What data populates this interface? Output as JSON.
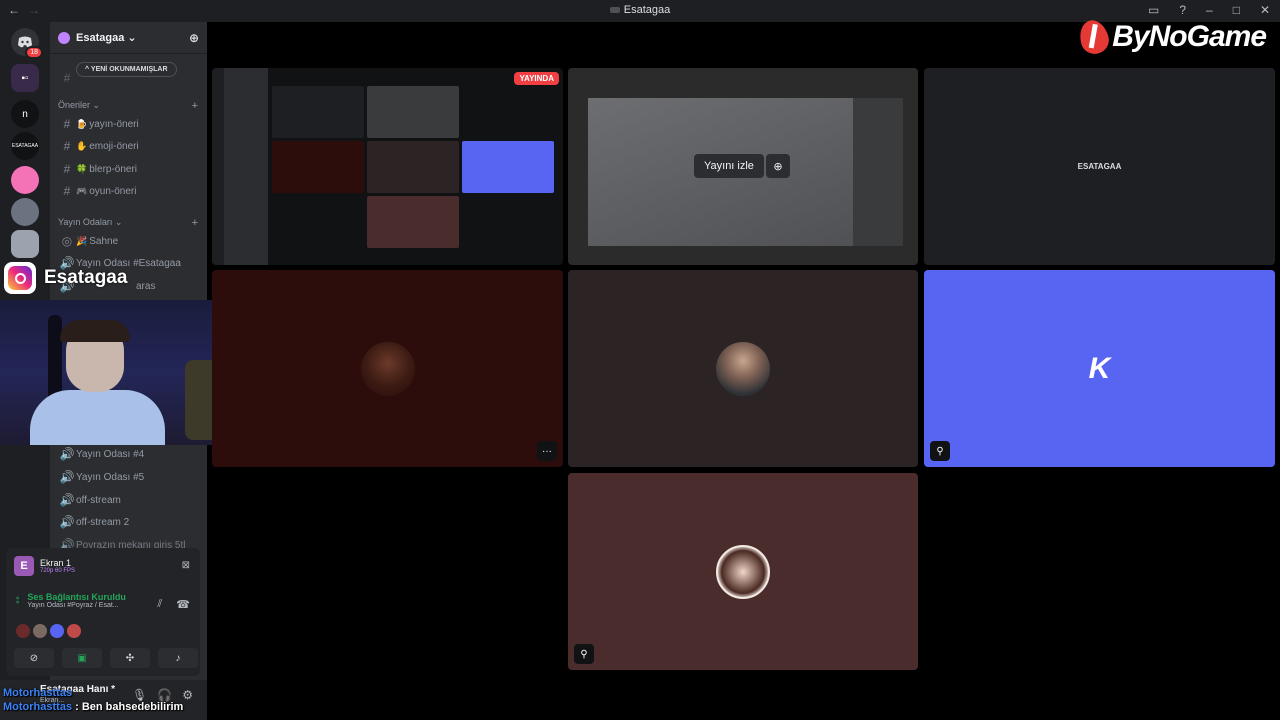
{
  "window": {
    "title": "Esatagaa"
  },
  "server": {
    "name": "Esatagaa",
    "unread_label": "YENİ OKUNMAMIŞLAR"
  },
  "rail": {
    "items": [
      {
        "icon": "discord-icon",
        "badge": "18"
      },
      {
        "icon": "server-icon"
      },
      {
        "icon": "server-icon",
        "label": "n"
      },
      {
        "icon": "server-icon",
        "label": "ESATAGAA"
      },
      {
        "icon": "server-icon"
      },
      {
        "icon": "server-icon"
      },
      {
        "icon": "server-icon"
      }
    ]
  },
  "categories": {
    "oneriler": "Öneriler",
    "yayin_odalari": "Yayın Odaları"
  },
  "channels": {
    "suggestions": [
      {
        "emoji": "🍺",
        "name": "yayın-öneri"
      },
      {
        "emoji": "✋",
        "name": "emoji-öneri"
      },
      {
        "emoji": "🍀",
        "name": "blerp-öneri"
      },
      {
        "emoji": "🎮",
        "name": "oyun-öneri"
      }
    ],
    "stage": {
      "emoji": "🎉",
      "name": "Sahne"
    },
    "voice_top": [
      "Yayın Odası #Esatagaa",
      "aras"
    ],
    "voice_bottom": [
      "Yayın Odası #4",
      "Yayın Odası #5",
      "off-stream",
      "off-stream 2",
      "Poyrazın mekanı giriş 5tl"
    ]
  },
  "overlay": {
    "instagram_handle": "Esatagaa"
  },
  "voice_panel": {
    "screen_title": "Ekran 1",
    "screen_quality": "720p 60 FPS",
    "status": "Ses Bağlantısı Kuruldu",
    "channel": "Yayın Odası #Poyraz / Esat...",
    "avatar_colors": [
      "#6b2a2a",
      "#7b6a62",
      "#5865f2",
      "#c04a4a"
    ]
  },
  "user_panel": {
    "name": "Esatagaa Hanı *",
    "sub": "Ekran..."
  },
  "chat": [
    {
      "user": "Motorhasttas",
      "message": ""
    },
    {
      "user": "Motorhasttas",
      "message": " : Ben bahsedebilirim"
    }
  ],
  "tiles": {
    "live_label": "YAYINDA",
    "watch_label": "Yayını izle",
    "esatagaa_label": "ESATAGAA",
    "k_letter": "K"
  },
  "brand": {
    "logo_text": "ByNoGame",
    "accent": "#e53935"
  },
  "colors": {
    "blurple": "#5865f2",
    "green": "#23a55a",
    "red": "#f23f43"
  }
}
